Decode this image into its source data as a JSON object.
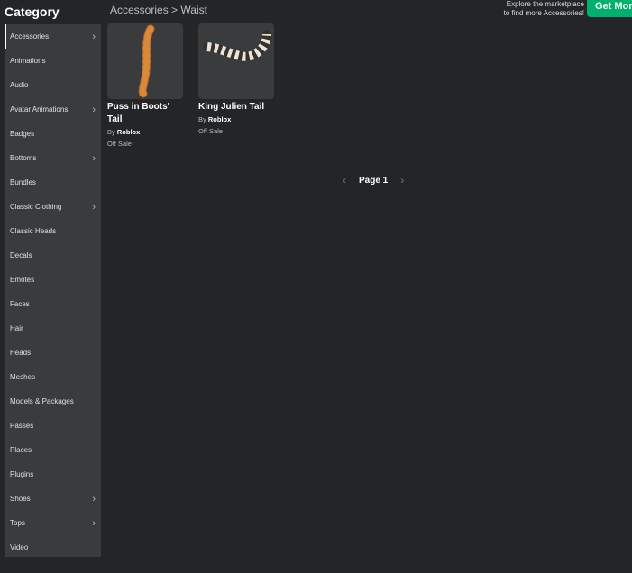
{
  "sidebar": {
    "title": "Category",
    "items": [
      {
        "label": "Accessories",
        "chevron": true
      },
      {
        "label": "Animations"
      },
      {
        "label": "Audio"
      },
      {
        "label": "Avatar Animations",
        "chevron": true
      },
      {
        "label": "Badges"
      },
      {
        "label": "Bottoms",
        "chevron": true
      },
      {
        "label": "Bundles"
      },
      {
        "label": "Classic Clothing",
        "chevron": true
      },
      {
        "label": "Classic Heads"
      },
      {
        "label": "Decals"
      },
      {
        "label": "Emotes"
      },
      {
        "label": "Faces"
      },
      {
        "label": "Hair"
      },
      {
        "label": "Heads"
      },
      {
        "label": "Meshes"
      },
      {
        "label": "Models & Packages"
      },
      {
        "label": "Passes"
      },
      {
        "label": "Places"
      },
      {
        "label": "Plugins"
      },
      {
        "label": "Shoes",
        "chevron": true
      },
      {
        "label": "Tops",
        "chevron": true
      },
      {
        "label": "Video"
      }
    ]
  },
  "breadcrumb": {
    "parent": "Accessories",
    "sep": ">",
    "current": "Waist"
  },
  "promo": {
    "line1": "Explore the marketplace",
    "line2": "to find more Accessories!",
    "button": "Get More"
  },
  "items": [
    {
      "name": "Puss in Boots' Tail",
      "by": "By",
      "creator": "Roblox",
      "status": "Off Sale"
    },
    {
      "name": "King Julien Tail",
      "by": "By",
      "creator": "Roblox",
      "status": "Off Sale"
    }
  ],
  "pager": {
    "prev": "‹",
    "label": "Page 1",
    "next": "›"
  }
}
